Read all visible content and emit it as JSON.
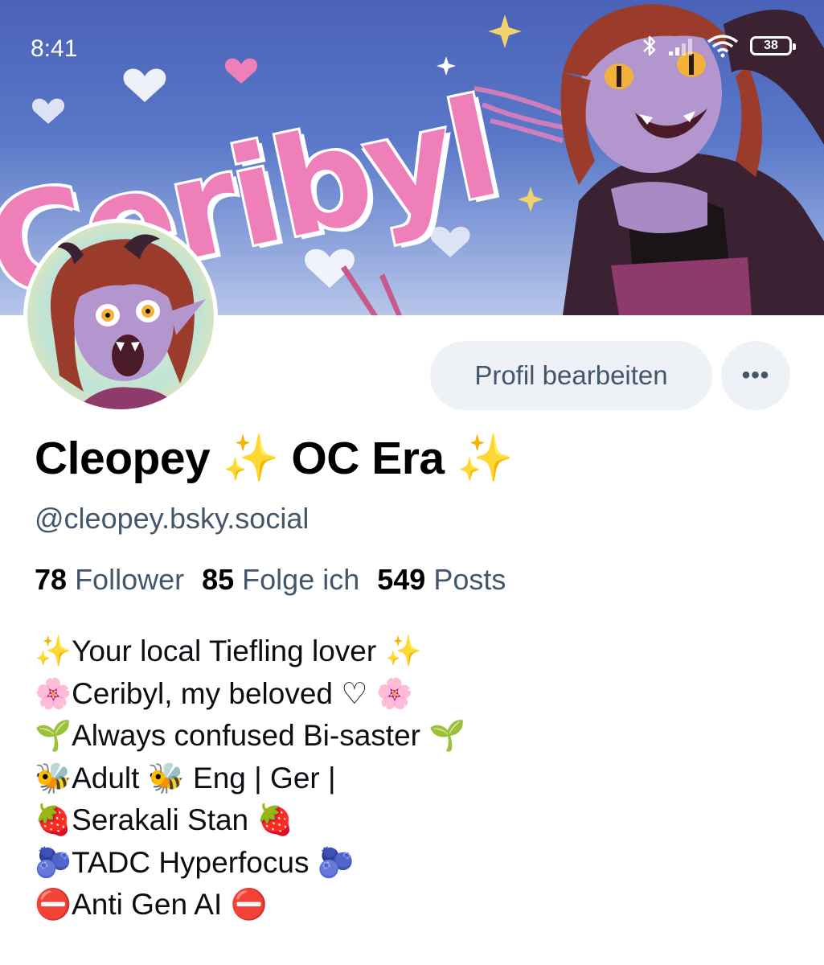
{
  "status_bar": {
    "time": "8:41",
    "battery": "38",
    "icons": [
      "bluetooth-icon",
      "signal-icon",
      "wifi-icon",
      "battery-icon"
    ]
  },
  "banner": {
    "title": "Ceribyl"
  },
  "profile": {
    "display_name": "Cleopey ✨ OC Era ✨",
    "handle": "@cleopey.bsky.social",
    "edit_button": "Profil bearbeiten",
    "more_button": "•••"
  },
  "stats": {
    "followers_count": "78",
    "followers_label": "Follower",
    "following_count": "85",
    "following_label": "Folge ich",
    "posts_count": "549",
    "posts_label": "Posts"
  },
  "bio": [
    "✨Your local Tiefling lover ✨",
    "🌸Ceribyl, my beloved ♡ 🌸",
    "🌱Always confused Bi-saster 🌱",
    "🐝Adult 🐝 Eng | Ger |",
    "🍓Serakali Stan 🍓",
    "🫐TADC Hyperfocus 🫐",
    "⛔Anti Gen AI ⛔"
  ],
  "colors": {
    "secondary_text": "#42576c",
    "button_bg": "#eef2f7",
    "banner_pink": "#ee7fb9"
  }
}
